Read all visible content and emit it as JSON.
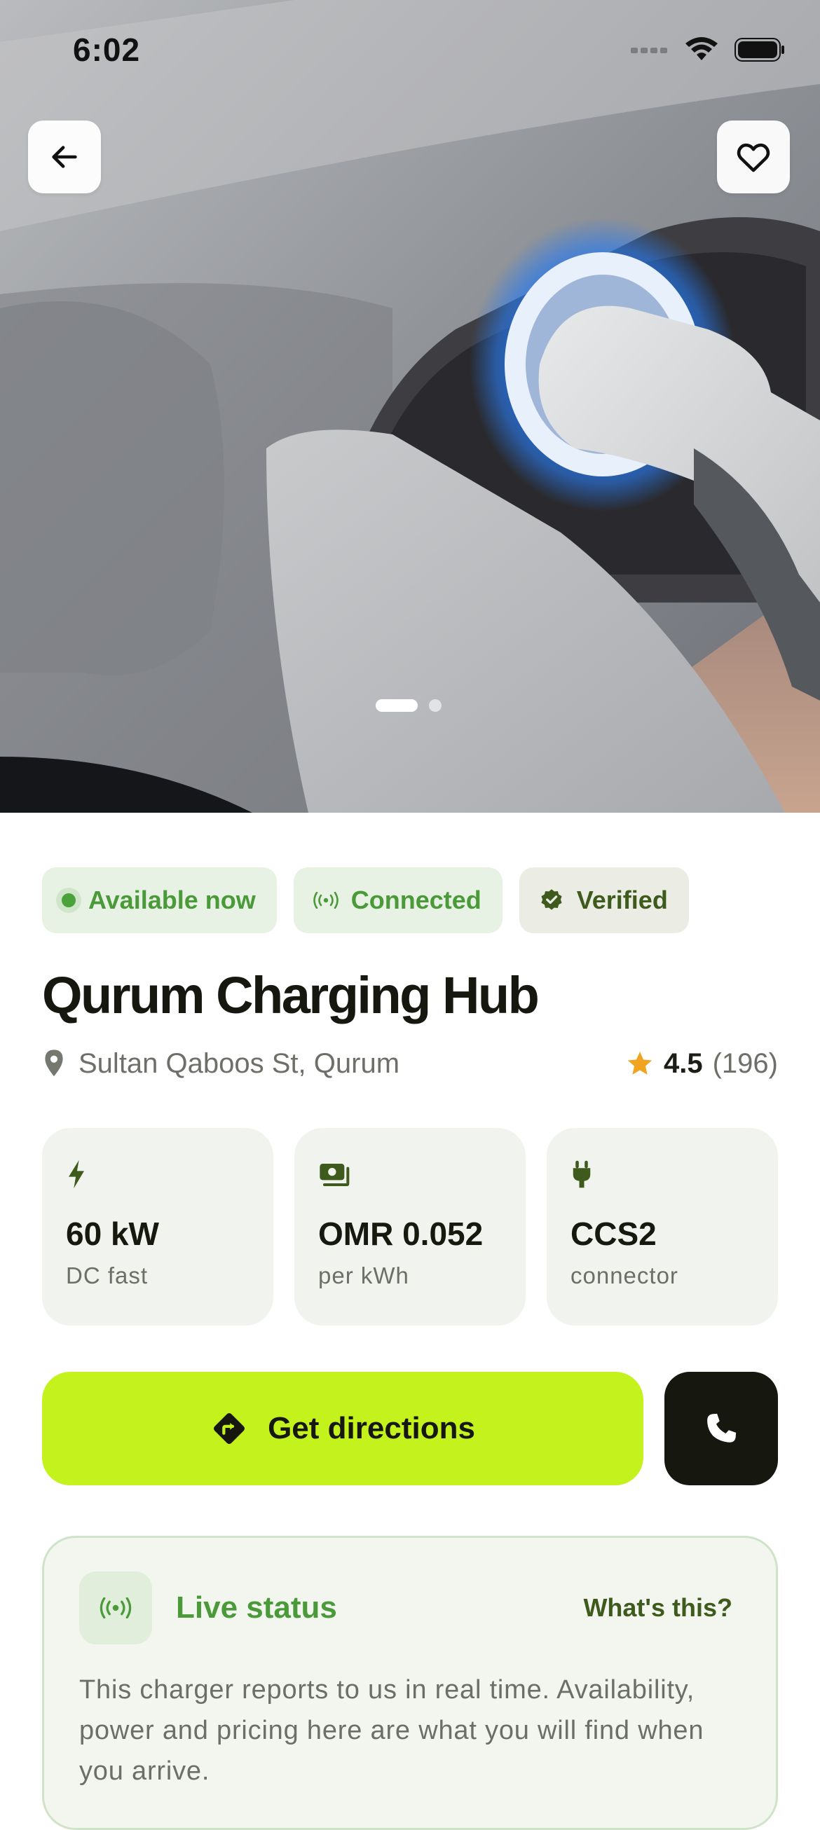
{
  "status_bar": {
    "time": "6:02"
  },
  "hero": {
    "image_subject": "EV charging connector plugged into car port",
    "back_icon": "arrow-left-icon",
    "favorite_icon": "heart-outline-icon",
    "carousel": {
      "count": 2,
      "active_index": 0
    }
  },
  "chips": {
    "available": "Available now",
    "connected": "Connected",
    "verified": "Verified"
  },
  "station": {
    "name": "Qurum Charging Hub",
    "address": "Sultan Qaboos St, Qurum",
    "rating": "4.5",
    "reviews": "(196)"
  },
  "specs": [
    {
      "icon": "bolt-icon",
      "value": "60 kW",
      "label": "DC fast"
    },
    {
      "icon": "cash-icon",
      "value": "OMR 0.052",
      "label": "per kWh"
    },
    {
      "icon": "plug-icon",
      "value": "CCS2",
      "label": "connector"
    }
  ],
  "actions": {
    "directions_label": "Get directions",
    "directions_icon": "directions-icon",
    "call_icon": "phone-icon"
  },
  "live_status": {
    "title": "Live status",
    "link": "What's this?",
    "description": "This charger reports to us in real time. Availability, power and pricing here are what you will find when you arrive."
  },
  "colors": {
    "accent_lime": "#c3f21c",
    "live_green": "#4a9a3a",
    "dark": "#16180f",
    "star": "#f0a422"
  }
}
